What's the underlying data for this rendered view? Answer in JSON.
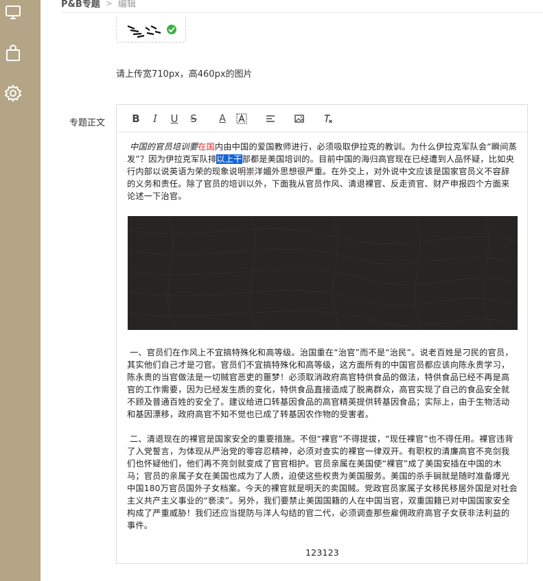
{
  "sidebar": {
    "icons": [
      "monitor-icon",
      "bag-icon",
      "gear-icon"
    ],
    "color": "#b3a585"
  },
  "breadcrumb": {
    "first": "P&B专题",
    "separator": ">",
    "last": "编辑"
  },
  "upload": {
    "hint": "请上传宽710px，高460px的图片"
  },
  "form": {
    "content_label": "专题正文"
  },
  "toolbar": {
    "bold": "B",
    "italic": "I",
    "underline": "U",
    "strike": "S",
    "font_color": "A"
  },
  "content": {
    "intro_a": "中国的官员培训要",
    "intro_red": "在国",
    "intro_b": "内由中国的爱国教师进行，必须吸取伊拉克的教训。为什么伊拉克军队会“瞬间蒸发”？因为伊拉克军队排",
    "intro_hl": "以上干",
    "intro_c": "部都是美国培训的。目前中国的海归高官现在已经遭到人品怀疑，比如央行内部以说英语为荣的现象说明崇洋媚外思想很严重。在外交上，对外说中文应该是国家官员义不容辞的义务和责任。除了官员的培训以外，下面我从官员作风、清退裸官、反走资官、财产申报四个方面来论述一下治官。",
    "para1": "一、官员们在作风上不宜搞特殊化和高等级。治国重在“治官”而不是“治民”。说老百姓是刁民的官员，其实他们自己才是刁官。官员们不宜搞特殊化和高等级，这方面所有的中国官员都应该向陈永贵学习，陈永贵的当官做法是一切贼官恶吏的噩梦！必须取消政府高官特供食品的做法，特供食品已经不再是高官的工作需要，因为已经发生质的变化，特供食品直接造成了脱离群众，高官实现了自己的食品安全就不顾及普通百姓的安全了。建议给进口转基因食品的高官精英提供转基因食品；实际上，由于生物活动和基因漂移，政府高官不知不觉也已成了转基因农作物的受害者。",
    "para2": "二、清退现在的裸官是国家安全的重要措施。不但“裸官”不得提拔，“现任裸官”也不得任用。裸官违背了入党誓言，为体现从严治党的零容忍精神，必须对查实的裸官一律双开。有职权的清廉高官不亮剑我们也怀疑他们，他们再不亮剑就变成了官官相护。官员亲属在美国使“裸官”成了美国安插在中国的木马；官员的亲属子女在美国也成为了人质，迫使这些权贵为美国服务。美国的杀手锏就是随时准备爆光中国180万官员国外子女档案。今天的裸官就是明天的卖国贼。党政官员家属子女移民移居外国是对社会主义共产主义事业的“亵渎”。另外，我们要禁止美国国籍的人在中国当官，双重国籍已对中国国家安全构成了严重威胁！我们还应当提防与洋人勾结的官二代，必须调查那些雇佣政府高官子女获非法利益的事件。",
    "footer_text": "123123"
  },
  "colors": {
    "accent_red": "#e2262a",
    "selection_blue": "#1565d8",
    "image_dark": "#262523"
  }
}
